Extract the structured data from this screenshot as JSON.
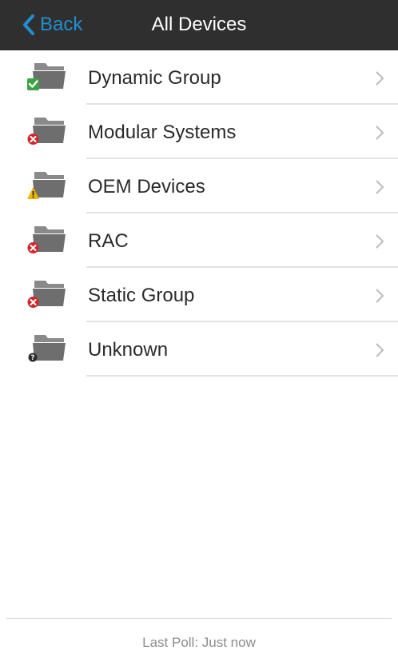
{
  "navbar": {
    "back_label": "Back",
    "title": "All Devices"
  },
  "groups": [
    {
      "label": "Dynamic Group",
      "status": "ok",
      "status_icon": "green-check-icon",
      "status_color": "#3aa541"
    },
    {
      "label": "Modular Systems",
      "status": "critical",
      "status_icon": "red-error-icon",
      "status_color": "#d3262c"
    },
    {
      "label": "OEM Devices",
      "status": "warning",
      "status_icon": "yellow-warning-icon",
      "status_color": "#f0b400"
    },
    {
      "label": "RAC",
      "status": "critical",
      "status_icon": "red-error-icon",
      "status_color": "#d3262c"
    },
    {
      "label": "Static Group",
      "status": "critical",
      "status_icon": "red-error-icon",
      "status_color": "#d3262c"
    },
    {
      "label": "Unknown",
      "status": "unknown",
      "status_icon": "unknown-question-icon",
      "status_color": "#2a2a2a"
    }
  ],
  "colors": {
    "navbar_bg": "#2f2f2f",
    "accent": "#1f8fd4",
    "folder": "#707070"
  },
  "footer": {
    "last_poll": "Last Poll: Just now"
  }
}
